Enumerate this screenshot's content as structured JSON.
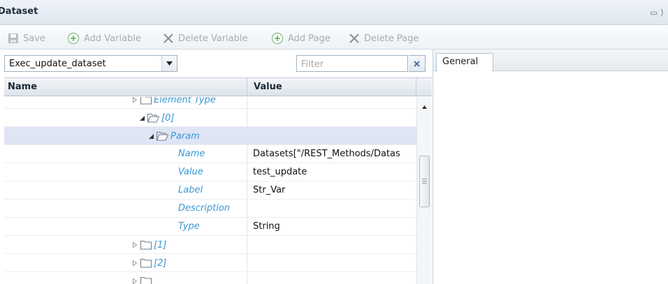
{
  "window": {
    "title": "Dataset"
  },
  "toolbar": {
    "save_label": "Save",
    "add_variable_label": "Add Variable",
    "delete_variable_label": "Delete Variable",
    "add_page_label": "Add Page",
    "delete_page_label": "Delete Page"
  },
  "dataset_select": {
    "value": "Exec_update_dataset"
  },
  "filter": {
    "placeholder": "Filter"
  },
  "grid": {
    "columns": {
      "name": "Name",
      "value": "Value"
    },
    "rows": [
      {
        "kind": "node",
        "label": "Element Type",
        "expanded": false,
        "level": 0
      },
      {
        "kind": "node",
        "label": "[0]",
        "expanded": true,
        "level": 0
      },
      {
        "kind": "node",
        "label": "Param",
        "expanded": true,
        "level": 1,
        "selected": true
      },
      {
        "kind": "prop",
        "label": "Name",
        "value": "Datasets[\"/REST_Methods/Datas"
      },
      {
        "kind": "prop",
        "label": "Value",
        "value": "test_update"
      },
      {
        "kind": "prop",
        "label": "Label",
        "value": "Str_Var"
      },
      {
        "kind": "prop",
        "label": "Description",
        "value": ""
      },
      {
        "kind": "prop",
        "label": "Type",
        "value": "String"
      },
      {
        "kind": "node",
        "label": "[1]",
        "expanded": false,
        "level": 0
      },
      {
        "kind": "node",
        "label": "[2]",
        "expanded": false,
        "level": 0
      }
    ]
  },
  "right_panel": {
    "tabs": [
      {
        "label": "General",
        "active": true
      }
    ]
  },
  "colors": {
    "tree_label": "#3a97d8",
    "selected_row": "#dfe5f5",
    "toolbar_disabled": "#a4acb6"
  }
}
